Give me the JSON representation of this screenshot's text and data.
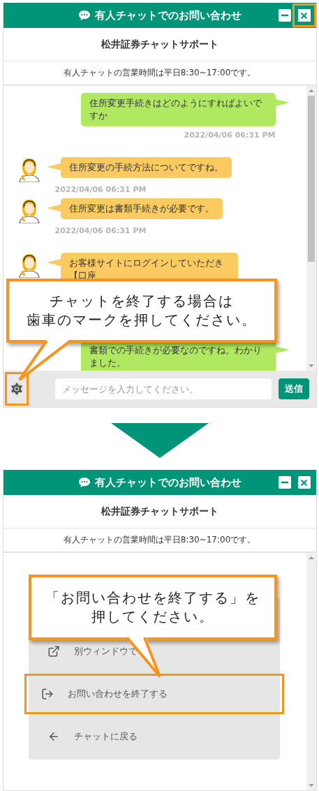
{
  "panels": [
    {
      "kind": "chat",
      "header": {
        "title": "有人チャットでのお問い合わせ",
        "buttons": [
          {
            "kind": "minimize",
            "highlighted": false
          },
          {
            "kind": "close",
            "highlighted": true
          }
        ]
      },
      "subtitle": "松井証券チャットサポート",
      "hours": "有人チャットの営業時間は平日8:30~17:00です。",
      "messages": [
        {
          "kind": "user",
          "text": "住所変更手続きはどのようにすればよいですか",
          "time": "2022/04/06 06:31 PM"
        },
        {
          "kind": "operator",
          "text": "住所変更の手続方法についてですね。",
          "time": "2022/04/06 06:31 PM"
        },
        {
          "kind": "operator",
          "text": "住所変更は書類手続きが必要です。",
          "time": "2022/04/06 06:31 PM"
        },
        {
          "kind": "operator",
          "text": "お客様サイトにログインしていただき【口座"
        },
        {
          "kind": "user",
          "text": "書類での手続きが必要なのですね。わかりました。"
        }
      ],
      "input": {
        "placeholder": "メッセージを入力してください。",
        "send": "送信"
      },
      "settings": {
        "highlighted": true
      },
      "callout": [
        "チャットを終了する場合は",
        "歯車のマークを押してください。"
      ]
    },
    {
      "kind": "menu",
      "header": {
        "title": "有人チャットでのお問い合わせ",
        "buttons": [
          {
            "kind": "minimize",
            "highlighted": false
          },
          {
            "kind": "close",
            "highlighted": false
          }
        ]
      },
      "subtitle": "松井証券チャットサポート",
      "hours": "有人チャットの営業時間は平日8:30~17:00です。",
      "menu": [
        {
          "kind": "open-window",
          "label": "別ウィンドウで",
          "highlighted": false
        },
        {
          "kind": "exit",
          "label": "お問い合わせを終了する",
          "highlighted": true
        },
        {
          "kind": "back",
          "label": "チャットに戻る",
          "highlighted": false
        }
      ],
      "callout": [
        "「お問い合わせを終了する」を",
        "押してください。"
      ]
    }
  ]
}
